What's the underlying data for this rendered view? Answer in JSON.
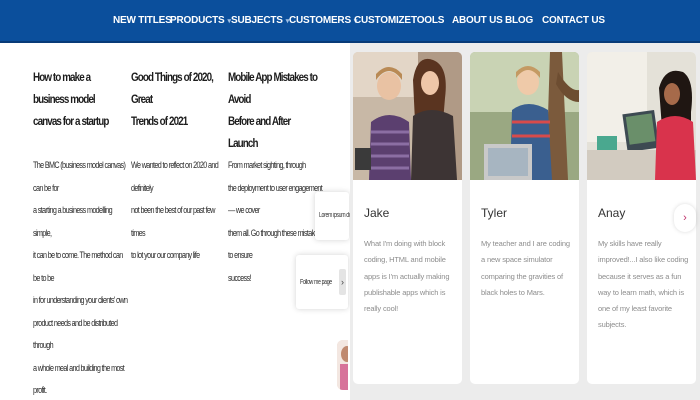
{
  "nav": {
    "items": [
      {
        "label": "NEW TITLES",
        "dropdown": false
      },
      {
        "label": "PRODUCTS",
        "dropdown": true
      },
      {
        "label": "SUBJECTS",
        "dropdown": true
      },
      {
        "label": "CUSTOMERS",
        "dropdown": true
      },
      {
        "label": "CUSTOMIZE",
        "dropdown": false
      },
      {
        "label": "TOOLS",
        "dropdown": false
      },
      {
        "label": "ABOUT US",
        "dropdown": false
      },
      {
        "label": "BLOG",
        "dropdown": false
      },
      {
        "label": "CONTACT US",
        "dropdown": false
      }
    ],
    "caret": "▾"
  },
  "blog_posts": [
    {
      "title_lines": [
        "How to make a business model",
        "canvas for a startup"
      ],
      "text_lines": [
        "The BMC (business model canvas) can be for",
        "a starting a business modelling simple,",
        "it can be to come. The method can be to be",
        "in for understanding your clients' own",
        "product needs and be distributed through",
        "a whole meal and building the most",
        "profit."
      ]
    },
    {
      "title_lines": [
        "Good Things of 2020, Great",
        "Trends of 2021"
      ],
      "text_lines": [
        "We wanted to reflect on 2020 and definitely",
        "not been the best of our past few times",
        "to lot your our company life"
      ]
    },
    {
      "title_lines": [
        "Mobile App Mistakes to Avoid",
        "Before and After Launch"
      ],
      "text_lines": [
        "From market sighting, through",
        "the deployment to user engagement — we cover",
        "them all. Go through these mistakes to ensure",
        "success!"
      ]
    }
  ],
  "mini_cards": [
    {
      "text": "Lorem ipsum dolor"
    },
    {
      "text": "Follow me page",
      "arrow": "›"
    }
  ],
  "testimonials": [
    {
      "name": "Jake",
      "quote": "What I'm doing with block coding, HTML and mobile apps is I'm actually making publishable apps which is really cool!"
    },
    {
      "name": "Tyler",
      "quote": "My teacher and I are coding a new space simulator comparing the gravities of black holes to Mars."
    },
    {
      "name": "Anay",
      "quote": "My skills have really improved!...I also like coding because it serves as a fun way to learn math, which is one of my least favorite subjects."
    }
  ],
  "next_button": "›",
  "colors": {
    "nav_bg": "#0b4f9c",
    "panel_bg": "#ececec",
    "accent": "#c0306a"
  }
}
